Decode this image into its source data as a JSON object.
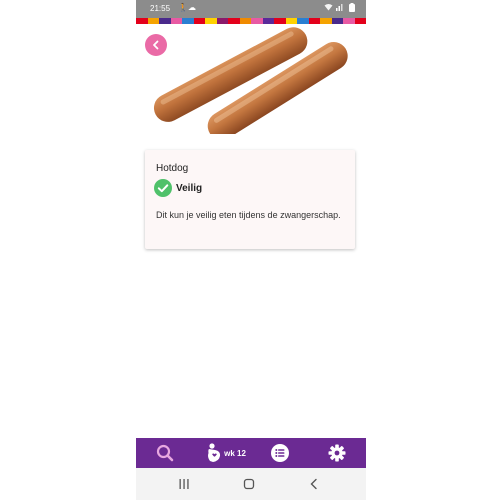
{
  "status_bar": {
    "time": "21:55",
    "icons": [
      "walking-icon",
      "cloud-icon",
      "wifi-icon",
      "signal-icon",
      "battery-icon"
    ]
  },
  "brand_stripe_colors": [
    "#e3001b",
    "#f5a300",
    "#4a2a8c",
    "#e85aa3",
    "#2a7fd2",
    "#e3001b",
    "#ffd200",
    "#8b1a6b",
    "#e3001b",
    "#f08a00",
    "#e85aa3",
    "#5a2a9a",
    "#e3001b",
    "#ffd200",
    "#2a7fd2",
    "#e3001b",
    "#f5a300",
    "#4a2a8c",
    "#e85aa3",
    "#e3001b"
  ],
  "header": {
    "image": "hotdog-sausages-image",
    "back_icon": "chevron-left-icon"
  },
  "card": {
    "title": "Hotdog",
    "status_icon": "checkmark-icon",
    "status_label": "Veilig",
    "description": "Dit kun je veilig eten tijdens de zwangerschap."
  },
  "bottom_nav": {
    "search_icon": "search-icon",
    "week_icon": "pregnant-belly-icon",
    "week_label": "wk 12",
    "list_icon": "list-icon",
    "settings_icon": "gear-icon"
  },
  "system_nav": {
    "recents": "recents-icon",
    "home": "home-icon",
    "back": "back-icon"
  },
  "colors": {
    "accent_pink": "#ea6aa6",
    "nav_purple": "#6b2a93",
    "safe_green": "#4fc16a",
    "card_bg": "#fdf7f7"
  }
}
